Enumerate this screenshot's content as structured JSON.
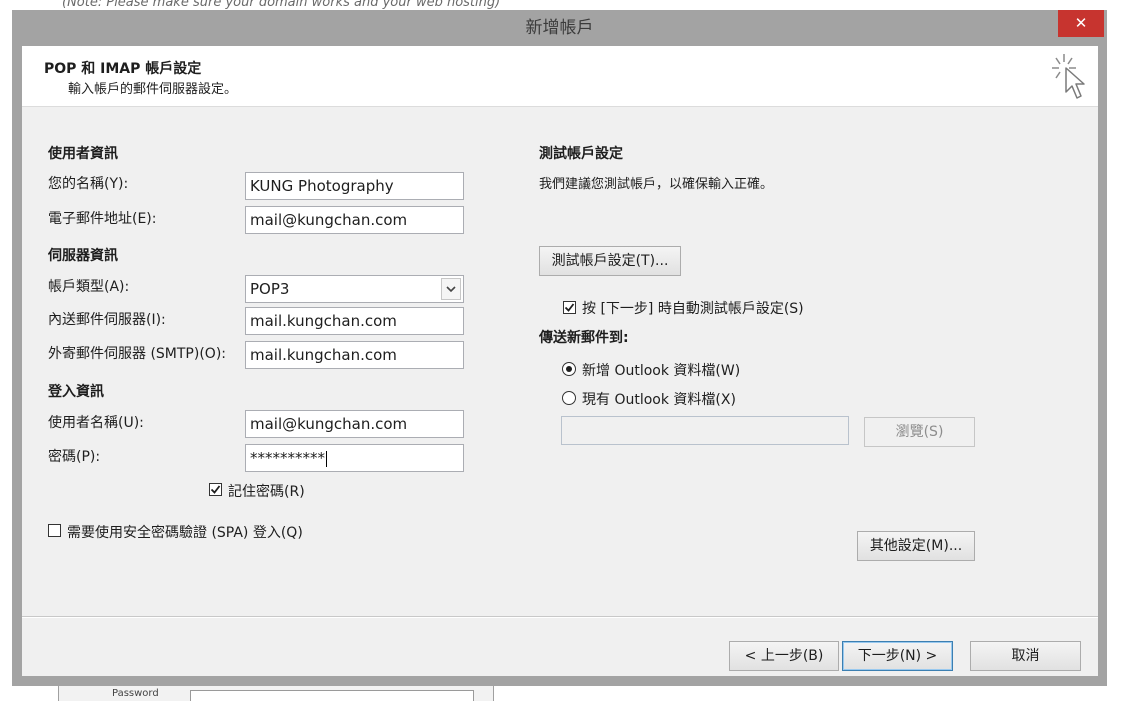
{
  "background_window": {
    "note_text": "(Note: Please make sure your domain works and your web hosting)",
    "bottom_label": "Password"
  },
  "dialog": {
    "title": "新增帳戶",
    "close_symbol": "✕"
  },
  "header": {
    "title": "POP 和 IMAP 帳戶設定",
    "subtitle": "輸入帳戶的郵件伺服器設定。"
  },
  "user_info": {
    "section_title": "使用者資訊",
    "name_label": "您的名稱(Y):",
    "name_value": "KUNG Photography",
    "email_label": "電子郵件地址(E):",
    "email_value": "mail@kungchan.com"
  },
  "server_info": {
    "section_title": "伺服器資訊",
    "account_type_label": "帳戶類型(A):",
    "account_type_value": "POP3",
    "incoming_label": "內送郵件伺服器(I):",
    "incoming_value": "mail.kungchan.com",
    "outgoing_label": "外寄郵件伺服器 (SMTP)(O):",
    "outgoing_value": "mail.kungchan.com"
  },
  "login_info": {
    "section_title": "登入資訊",
    "username_label": "使用者名稱(U):",
    "username_value": "mail@kungchan.com",
    "password_label": "密碼(P):",
    "password_value": "**********",
    "remember_label": "記住密碼(R)",
    "remember_checked": true
  },
  "spa": {
    "label": "需要使用安全密碼驗證 (SPA) 登入(Q)",
    "checked": false
  },
  "test_settings": {
    "section_title": "測試帳戶設定",
    "description": "我們建議您測試帳戶，以確保輸入正確。",
    "test_button": "測試帳戶設定(T)...",
    "auto_test_label": "按 [下一步] 時自動測試帳戶設定(S)",
    "auto_test_checked": true
  },
  "deliver": {
    "section_title": "傳送新郵件到:",
    "new_data_file_label": "新增 Outlook 資料檔(W)",
    "existing_data_file_label": "現有 Outlook 資料檔(X)",
    "selected": "new",
    "existing_path_value": "",
    "browse_button": "瀏覽(S)"
  },
  "more_settings_button": "其他設定(M)...",
  "footer": {
    "back_button": "< 上一步(B)",
    "next_button": "下一步(N) >",
    "cancel_button": "取消"
  },
  "icons": {
    "header_icon": "cursor-sparkle-icon",
    "dropdown_icon": "chevron-down-icon",
    "check_icon": "check-icon"
  },
  "colors": {
    "close_button": "#c7342f",
    "window_frame": "#a3a3a3",
    "client_bg": "#f0f0f0",
    "default_button_border": "#3c7fb1"
  }
}
